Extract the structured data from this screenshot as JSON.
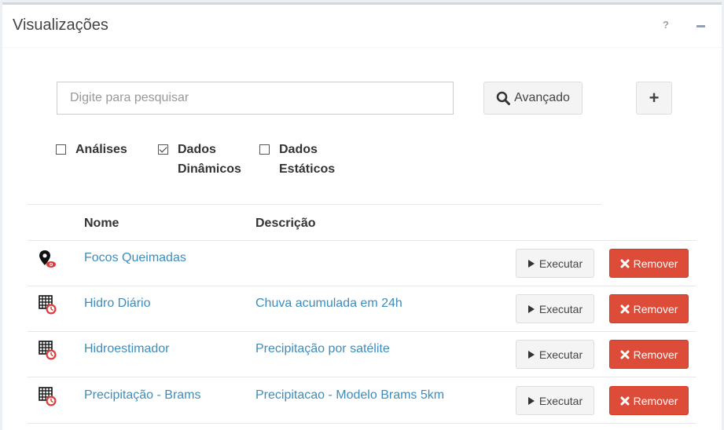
{
  "panel": {
    "title": "Visualizações",
    "help_label": "?",
    "minimize_icon": "minus-icon"
  },
  "search": {
    "placeholder": "Digite para pesquisar",
    "value": "",
    "advanced_label": "Avançado",
    "advanced_icon": "search-icon",
    "add_label": "+"
  },
  "filters": [
    {
      "label_lines": [
        "Análises"
      ],
      "checked": false
    },
    {
      "label_lines": [
        "Dados",
        "Dinâmicos"
      ],
      "checked": true
    },
    {
      "label_lines": [
        "Dados",
        "Estáticos"
      ],
      "checked": false
    }
  ],
  "table": {
    "headers": {
      "name": "Nome",
      "description": "Descrição"
    },
    "rows": [
      {
        "icon": "map-marker-eye-icon",
        "name": "Focos Queimadas",
        "description": ""
      },
      {
        "icon": "grid-clock-icon",
        "name": "Hidro Diário",
        "description": "Chuva acumulada em 24h"
      },
      {
        "icon": "grid-clock-icon",
        "name": "Hidroestimador",
        "description": "Precipitação por satélite"
      },
      {
        "icon": "grid-clock-icon",
        "name": "Precipitação - Brams",
        "description": "Precipitacao - Modelo Brams 5km"
      }
    ],
    "execute_label": "Executar",
    "remove_label": "Remover"
  },
  "colors": {
    "link": "#3c8dbc",
    "danger": "#dd4b39",
    "icon_accent": "#e03b3b"
  }
}
